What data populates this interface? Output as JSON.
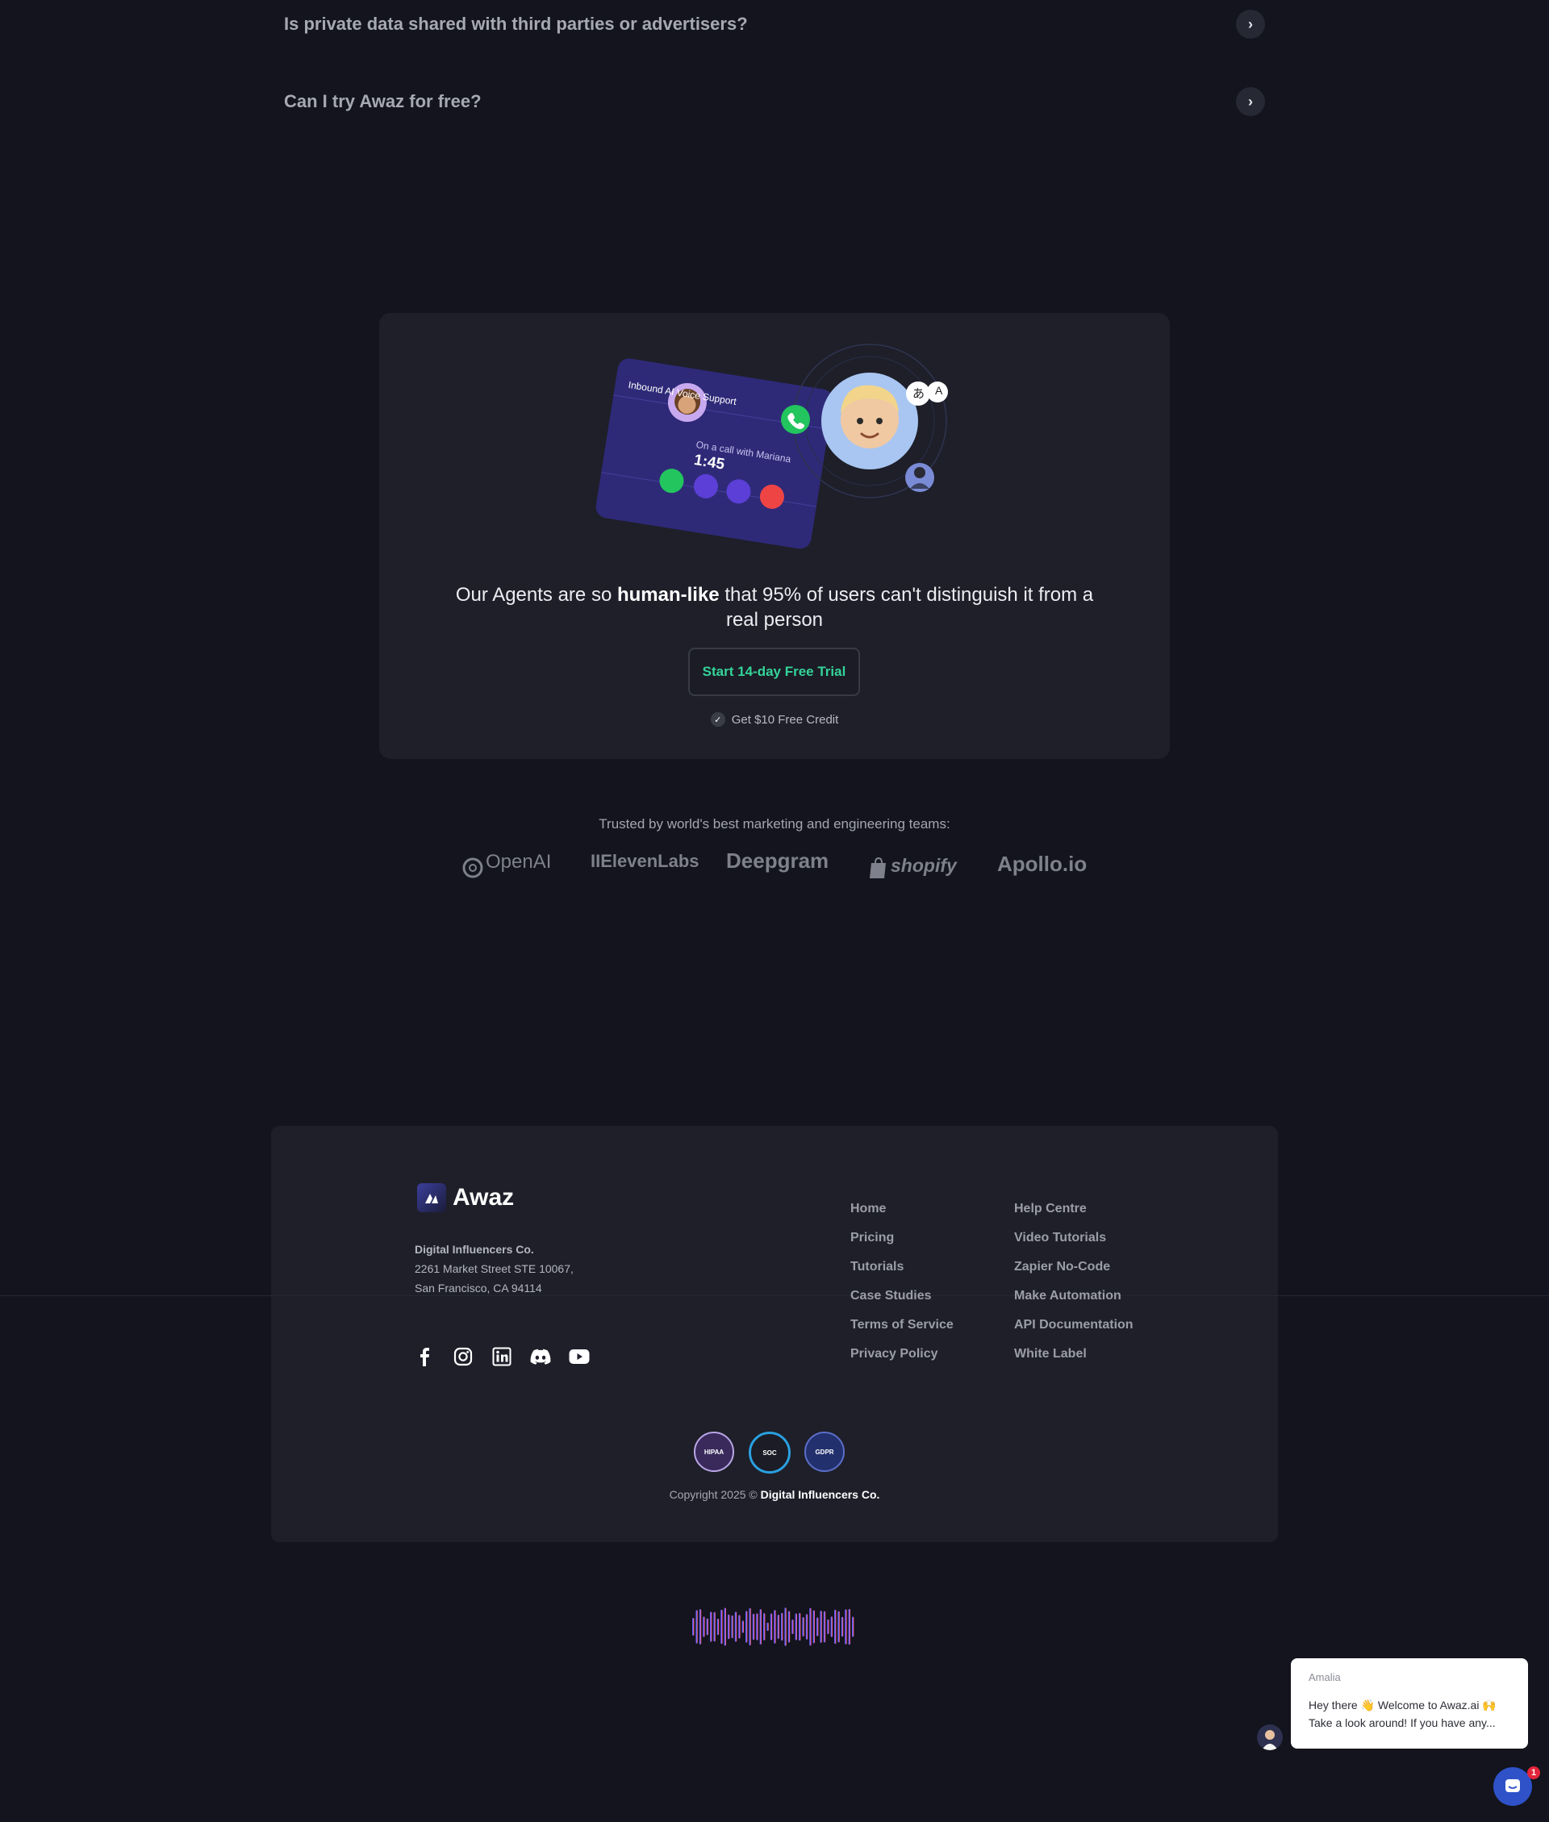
{
  "faq": [
    {
      "question": "Is private data shared with third parties or advertisers?",
      "icon": "chevron-right-icon"
    },
    {
      "question": "Can I try Awaz for free?",
      "icon": "chevron-right-icon"
    }
  ],
  "cta": {
    "call_card": {
      "title": "Inbound AI Voice Support",
      "status": "On a call with Mariana",
      "timer": "1:45"
    },
    "headline_pre": "Our Agents are so ",
    "headline_bold": "human-like",
    "headline_post": " that 95% of users can't distinguish it from a real person",
    "button_label": "Start 14-day Free Trial",
    "credit_label": "Get $10 Free Credit",
    "accent_color": "#34d399"
  },
  "trusted": {
    "label": "Trusted by world's best marketing and engineering teams:",
    "logos": [
      "OpenAI",
      "IIElevenLabs",
      "Deepgram",
      "shopify",
      "Apollo.io"
    ]
  },
  "footer": {
    "brand": "Awaz",
    "company": "Digital Influencers Co.",
    "address_line1": "2261 Market Street STE 10067,",
    "address_line2": "San Francisco, CA 94114",
    "social_icons": [
      "facebook-icon",
      "instagram-icon",
      "linkedin-icon",
      "discord-icon",
      "youtube-icon"
    ],
    "links_col1": [
      "Home",
      "Pricing",
      "Tutorials",
      "Case Studies",
      "Terms of Service",
      "Privacy Policy"
    ],
    "links_col2": [
      "Help Centre",
      "Video Tutorials",
      "Zapier No-Code",
      "Make Automation",
      "API Documentation",
      "White Label"
    ],
    "badges": [
      "HIPAA",
      "SOC",
      "GDPR"
    ],
    "copyright_prefix": "Copyright 2025 © ",
    "copyright_company": "Digital Influencers Co."
  },
  "chat": {
    "agent_name": "Amalia",
    "message_line1": "Hey there 👋 Welcome to Awaz.ai 🙌",
    "message_line2": "Take a look around! If you have any...",
    "unread_count": "1"
  }
}
